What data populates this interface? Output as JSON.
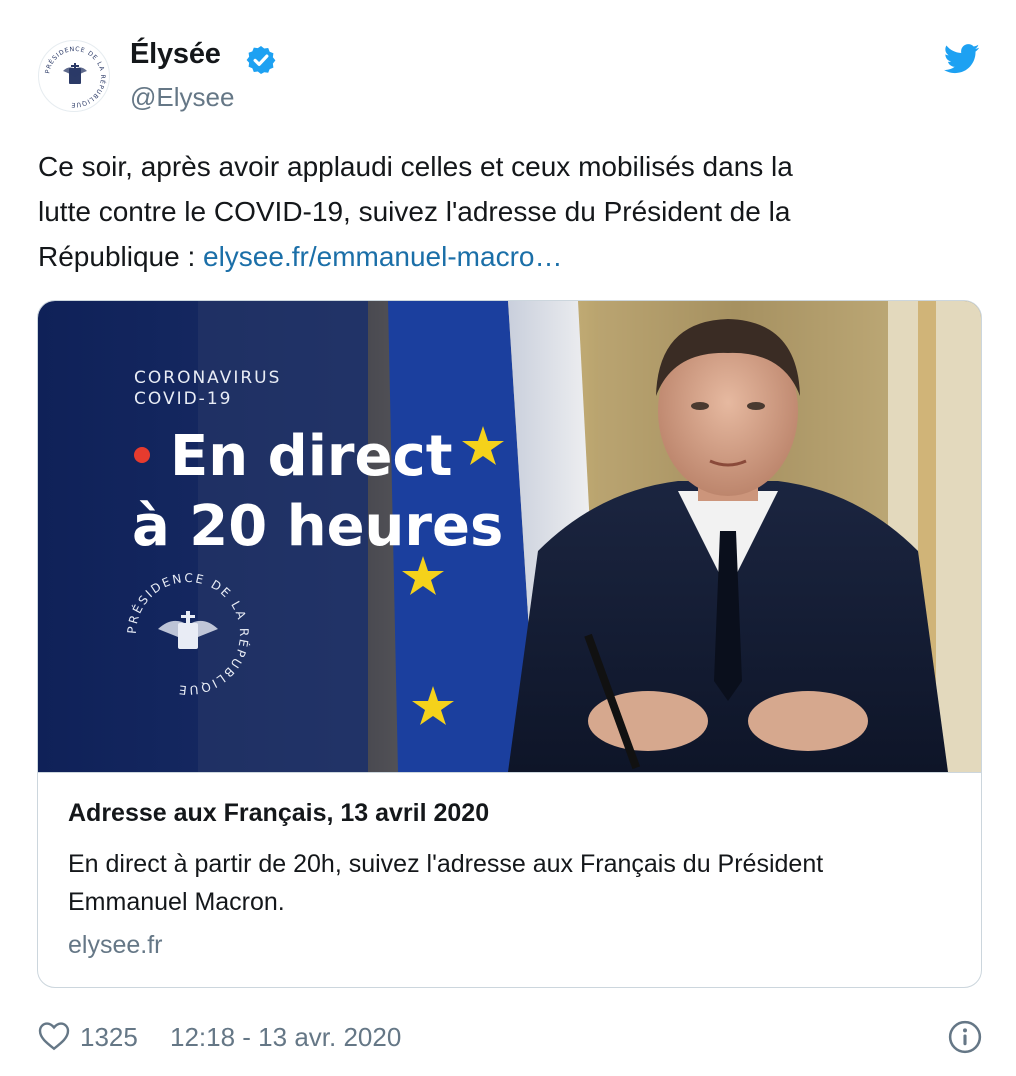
{
  "account": {
    "display_name": "Élysée",
    "handle": "@Elysee",
    "avatar_seal_text": "PRÉSIDENCE DE LA RÉPUBLIQUE"
  },
  "tweet": {
    "text_line1": "Ce soir, après avoir applaudi celles et ceux mobilisés dans la",
    "text_line2": "lutte contre le COVID-19, suivez l'adresse du Président de la",
    "text_line3": "République : ",
    "link_text": "elysee.fr/emmanuel-macro…"
  },
  "card": {
    "image": {
      "kicker_line1": "CORONAVIRUS",
      "kicker_line2": "COVID-19",
      "headline_line1": "En direct",
      "headline_line2": "à 20 heures",
      "seal_text": "PRÉSIDENCE DE LA RÉPUBLIQUE",
      "live_dot_color": "#e63b2e"
    },
    "title": "Adresse aux Français, 13 avril 2020",
    "description_line1": "En direct à partir de 20h, suivez l'adresse aux Français du Président",
    "description_line2": "Emmanuel Macron.",
    "domain": "elysee.fr"
  },
  "footer": {
    "like_count": "1325",
    "timestamp": "12:18 - 13 avr. 2020"
  },
  "icons": {
    "verified": "verified-badge-icon",
    "twitter": "twitter-bird-icon",
    "like": "heart-icon",
    "info": "info-icon"
  },
  "colors": {
    "twitter_blue": "#1da1f2",
    "link": "#1b6fa8",
    "secondary_text": "#657786",
    "card_border": "#ccd6dd"
  }
}
